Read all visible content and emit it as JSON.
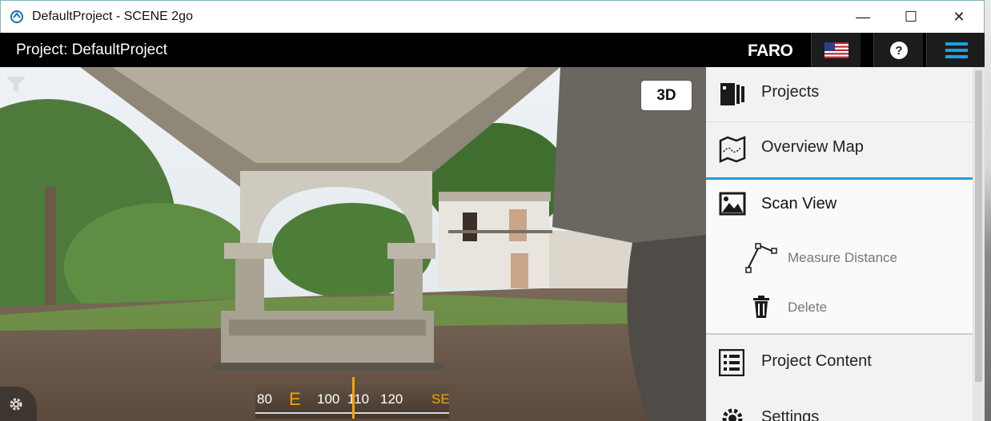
{
  "window": {
    "title": "DefaultProject - SCENE 2go",
    "minimize_glyph": "—",
    "maximize_glyph": "☐",
    "close_glyph": "✕"
  },
  "header": {
    "project_label": "Project: DefaultProject",
    "brand": "FARO",
    "flag_icon": "us-flag-icon",
    "help_icon": "help-icon",
    "menu_icon": "hamburger-menu-icon",
    "accent": "#1ba1e2"
  },
  "viewer": {
    "mode_button": "3D",
    "compass": {
      "labels": [
        "80",
        "E",
        "100",
        "110",
        "120",
        "SE"
      ],
      "marker_color": "#f5a500"
    }
  },
  "side_menu": {
    "items": [
      {
        "label": "Projects",
        "icon": "projects-icon"
      },
      {
        "label": "Overview Map",
        "icon": "map-icon"
      },
      {
        "label": "Scan View",
        "icon": "scan-view-icon",
        "selected": true
      },
      {
        "label": "Measure Distance",
        "icon": "measure-distance-icon",
        "sub": true
      },
      {
        "label": "Delete",
        "icon": "trash-icon",
        "sub": true
      },
      {
        "label": "Project Content",
        "icon": "list-icon"
      },
      {
        "label": "Settings",
        "icon": "gear-icon"
      }
    ]
  }
}
